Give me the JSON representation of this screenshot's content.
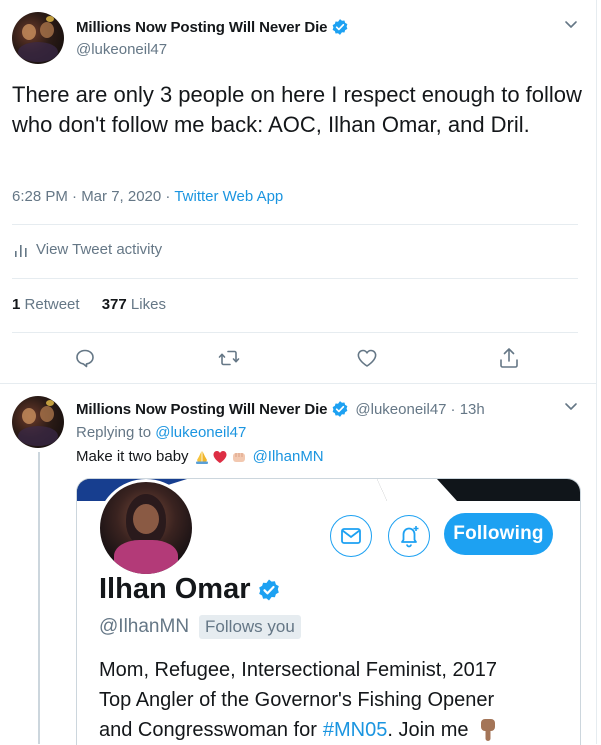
{
  "main_tweet": {
    "display_name": "Millions Now Posting Will Never Die",
    "handle": "@lukeoneil47",
    "text": "There are only 3 people on here I respect enough to follow who don't follow me back: AOC, Ilhan Omar, and Dril.",
    "timestamp": "6:28 PM · Mar 7, 2020",
    "separator": " · ",
    "source": "Twitter Web App",
    "activity_label": "View Tweet activity",
    "retweets_count": "1",
    "retweets_label": "Retweet",
    "likes_count": "377",
    "likes_label": "Likes",
    "icons": [
      "chevron-down-icon",
      "verified-badge-icon",
      "activity-bars-icon",
      "reply-icon",
      "retweet-icon",
      "like-icon",
      "share-icon"
    ]
  },
  "reply_tweet": {
    "display_name": "Millions Now Posting Will Never Die",
    "handle": "@lukeoneil47",
    "time_ago": "· 13h",
    "replying_prefix": "Replying to",
    "replying_to": "@lukeoneil47",
    "text": "Make it two baby",
    "emojis": [
      "folded-hands",
      "red-heart",
      "fist"
    ],
    "mention": "@IlhanMN"
  },
  "profile_card": {
    "name": "Ilhan Omar",
    "handle": "@IlhanMN",
    "follows_you": "Follows you",
    "follow_button": "Following",
    "bio_line1": "Mom, Refugee, Intersectional Feminist, 2017",
    "bio_line2": "Top Angler of the Governor's Fishing Opener",
    "bio_line3_prefix": "and Congresswoman for",
    "bio_hashtag": "#MN05",
    "bio_line3_suffix": ". Join me",
    "icons": [
      "mail-icon",
      "notification-bell-icon",
      "pointing-down-icon"
    ]
  },
  "colors": {
    "accent": "#1da1f2",
    "link": "#1b95e0",
    "text": "#14171a",
    "muted": "#657786",
    "divider": "#e6ecf0"
  }
}
